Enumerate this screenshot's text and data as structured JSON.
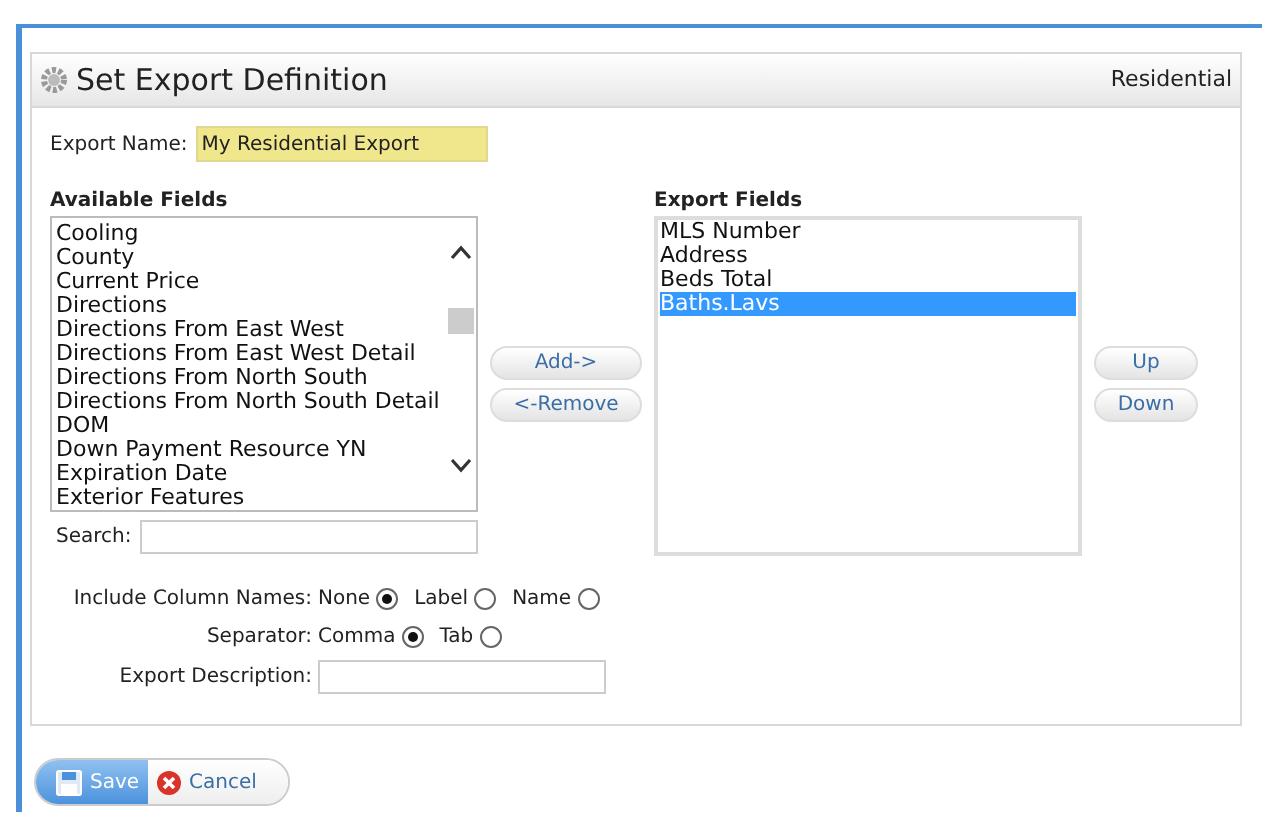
{
  "panel": {
    "title": "Set Export Definition",
    "context": "Residential"
  },
  "export_name": {
    "label": "Export Name:",
    "value": "My Residential Export"
  },
  "available_fields": {
    "heading": "Available Fields",
    "items": [
      {
        "label": "Cooling",
        "selected": false
      },
      {
        "label": "County",
        "selected": false
      },
      {
        "label": "Current Price",
        "selected": false
      },
      {
        "label": "Directions",
        "selected": false
      },
      {
        "label": "Directions From East West",
        "selected": false
      },
      {
        "label": "Directions From East West Detail",
        "selected": false
      },
      {
        "label": "Directions From North South",
        "selected": false
      },
      {
        "label": "Directions From North South Detail",
        "selected": false
      },
      {
        "label": "DOM",
        "selected": false
      },
      {
        "label": "Down Payment Resource YN",
        "selected": false
      },
      {
        "label": "Expiration Date",
        "selected": false
      },
      {
        "label": "Exterior Features",
        "selected": false
      }
    ]
  },
  "search": {
    "label": "Search:"
  },
  "move_buttons": [
    "Add->",
    "<-Remove"
  ],
  "export_fields": {
    "heading": "Export Fields",
    "items": [
      {
        "label": "MLS Number",
        "selected": false
      },
      {
        "label": "Address",
        "selected": false
      },
      {
        "label": "Beds Total",
        "selected": false
      },
      {
        "label": "Baths.Lavs",
        "selected": true
      }
    ]
  },
  "order_buttons": [
    "Up",
    "Down"
  ],
  "include_column_names": {
    "label": "Include Column Names:",
    "options": [
      {
        "label": "None",
        "selected": true
      },
      {
        "label": "Label",
        "selected": false
      },
      {
        "label": "Name",
        "selected": false
      }
    ]
  },
  "separator": {
    "label": "Separator:",
    "options": [
      {
        "label": "Comma",
        "selected": true
      },
      {
        "label": "Tab",
        "selected": false
      }
    ]
  },
  "export_description": {
    "label": "Export Description:"
  },
  "actions": [
    {
      "kind": "save",
      "label": "Save"
    },
    {
      "kind": "cancel",
      "label": "Cancel"
    }
  ]
}
